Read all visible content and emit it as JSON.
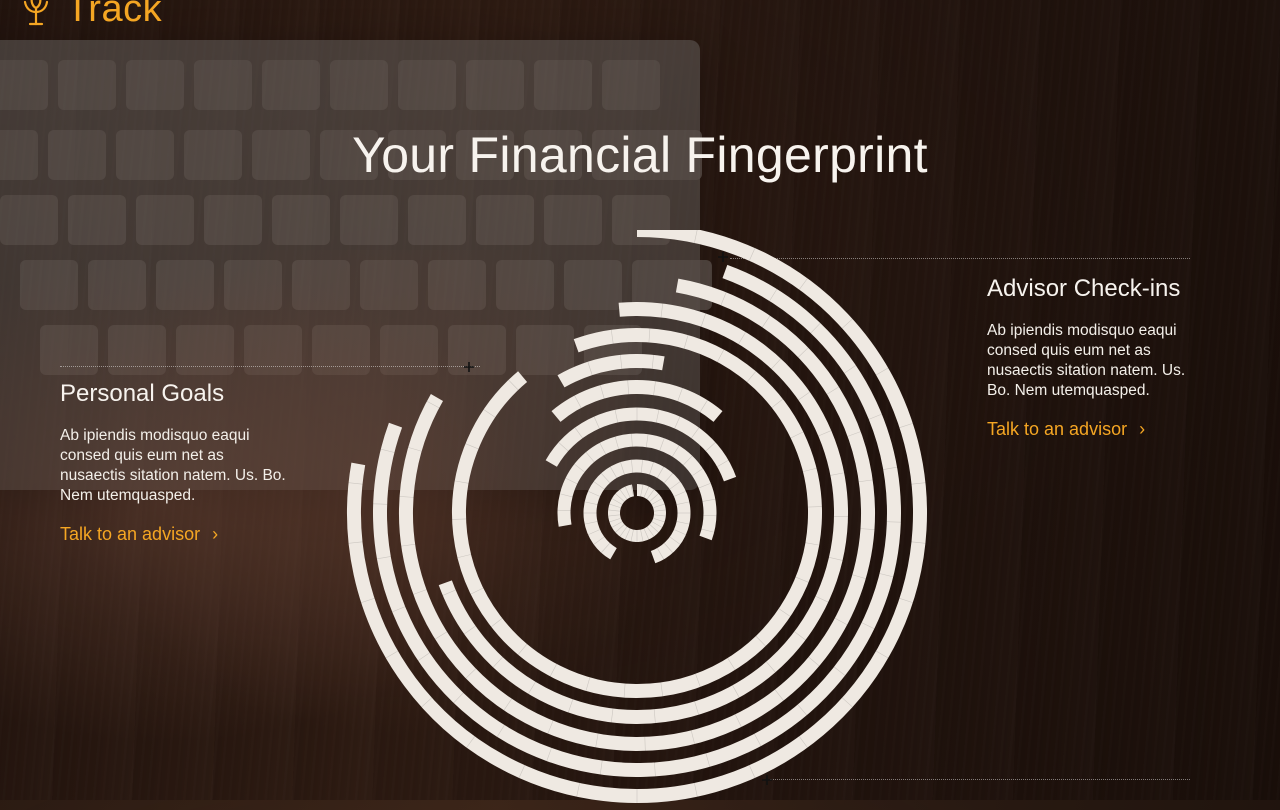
{
  "brand": {
    "name": "Track"
  },
  "page": {
    "title": "Your Financial Fingerprint"
  },
  "panels": {
    "personal_goals": {
      "title": "Personal Goals",
      "body": "Ab ipiendis modisquo eaqui consed quis eum net as nusaectis sitation natem. Us. Bo. Nem utemquasped.",
      "cta": "Talk to an advisor"
    },
    "advisor_checkins": {
      "title": "Advisor Check-ins",
      "body": "Ab ipiendis modisquo eaqui consed quis eum net as nusaectis sitation natem. Us. Bo. Nem utemquasped.",
      "cta": "Talk to an advisor"
    }
  },
  "colors": {
    "accent": "#f5a623",
    "text": "#f3efe9",
    "ring": "#efe9e2"
  },
  "icons": {
    "logo": "wheat-sheaf-icon",
    "chevron": "chevron-right-icon",
    "marker": "plus-marker-icon"
  }
}
